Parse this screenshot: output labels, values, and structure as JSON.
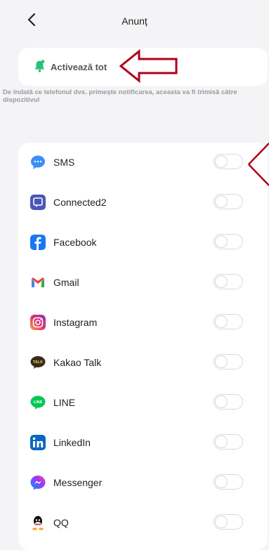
{
  "header": {
    "title": "Anunț"
  },
  "activate": {
    "label": "Activează tot"
  },
  "hint": "De îndată ce telefonul dvs. primește notificarea, aceasta va fi trimisă către dispozitivul",
  "apps": [
    {
      "name": "SMS",
      "icon": "sms-icon",
      "enabled": false
    },
    {
      "name": "Connected2",
      "icon": "connected2-icon",
      "enabled": false
    },
    {
      "name": "Facebook",
      "icon": "facebook-icon",
      "enabled": false
    },
    {
      "name": "Gmail",
      "icon": "gmail-icon",
      "enabled": false
    },
    {
      "name": "Instagram",
      "icon": "instagram-icon",
      "enabled": false
    },
    {
      "name": "Kakao Talk",
      "icon": "kakaotalk-icon",
      "enabled": false
    },
    {
      "name": "LINE",
      "icon": "line-icon",
      "enabled": false
    },
    {
      "name": "LinkedIn",
      "icon": "linkedin-icon",
      "enabled": false
    },
    {
      "name": "Messenger",
      "icon": "messenger-icon",
      "enabled": false
    },
    {
      "name": "QQ",
      "icon": "qq-icon",
      "enabled": false
    }
  ],
  "colors": {
    "accent": "#2bbf7a",
    "annotation": "#b00018"
  }
}
